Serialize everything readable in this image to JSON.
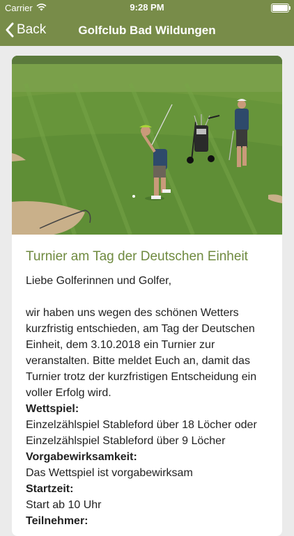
{
  "status_bar": {
    "carrier": "Carrier",
    "time": "9:28 PM"
  },
  "nav": {
    "back_label": "Back",
    "title": "Golfclub Bad Wildungen"
  },
  "colors": {
    "nav_background": "#788c49",
    "title_accent": "#6f8a3f",
    "page_background": "#ebebeb"
  },
  "hero_image": {
    "subject": "golf-course-photo"
  },
  "event": {
    "title": "Turnier am Tag der Deutschen Einheit",
    "greeting": "Liebe Golferinnen und Golfer,",
    "body_lines": [
      "wir haben uns wegen des schönen Wetters",
      "kurzfristig entschieden, am Tag der Deutschen",
      "Einheit, dem 3.10.2018 ein Turnier zur",
      "veranstalten. Bitte meldet Euch an, damit das",
      "Turnier trotz der kurzfristigen Entscheidung ein",
      "voller Erfolg wird."
    ],
    "details": [
      {
        "label": "Wettspiel:",
        "lines": [
          "Einzelzählspiel Stableford über 18 Löcher oder",
          "Einzelzählspiel Stableford über 9 Löcher"
        ]
      },
      {
        "label": "Vorgabewirksamkeit:",
        "lines": [
          "Das Wettspiel ist vorgabewirksam"
        ]
      },
      {
        "label": "Startzeit:",
        "lines": [
          "Start ab 10 Uhr"
        ]
      },
      {
        "label": "Teilnehmer:",
        "lines": []
      }
    ]
  }
}
